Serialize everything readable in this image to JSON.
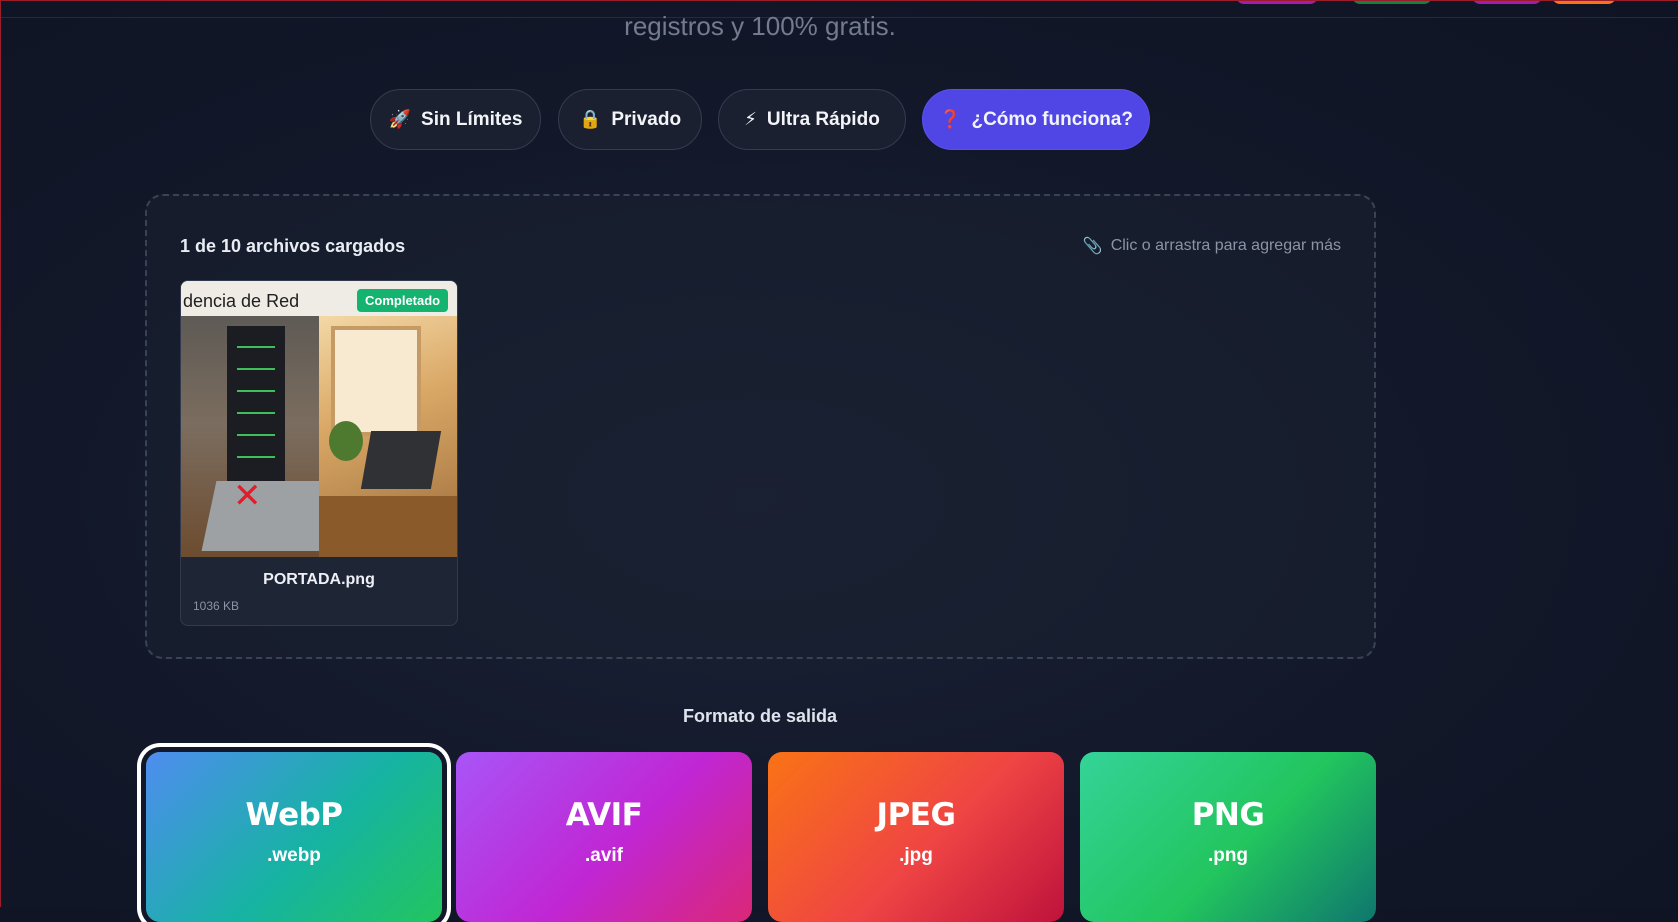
{
  "header": {
    "subtitle_fragment": "registros y 100% gratis."
  },
  "top_chip_colors": [
    "#a21caf",
    "#15803d",
    "#a21caf",
    "#f97316"
  ],
  "features": [
    {
      "label": "Sin Límites",
      "icon": "rocket-icon",
      "glyph": "🚀"
    },
    {
      "label": "Privado",
      "icon": "lock-icon",
      "glyph": "🔒"
    },
    {
      "label": "Ultra Rápido",
      "icon": "lightning-icon",
      "glyph": "⚡"
    },
    {
      "label": "¿Cómo funciona?",
      "icon": "question-icon",
      "glyph": "❓"
    }
  ],
  "upload": {
    "count_text": "1 de 10 archivos cargados",
    "hint_text": "Clic o arrastra para agregar más",
    "hint_icon": "paperclip-icon",
    "files": [
      {
        "name": "PORTADA.png",
        "size": "1036 KB",
        "status": "Completado",
        "thumb_text": "dencia de Red"
      }
    ]
  },
  "output": {
    "title": "Formato de salida",
    "selected": "WebP",
    "formats": [
      {
        "name": "WebP",
        "ext": ".webp",
        "gradient_from": "#4f8df0",
        "gradient_mid": "#16b3a3",
        "gradient_to": "#22c55e"
      },
      {
        "name": "AVIF",
        "ext": ".avif",
        "gradient_from": "#a855f7",
        "gradient_mid": "#c026d3",
        "gradient_to": "#db2777"
      },
      {
        "name": "JPEG",
        "ext": ".jpg",
        "gradient_from": "#f97316",
        "gradient_mid": "#ef4444",
        "gradient_to": "#be123c"
      },
      {
        "name": "PNG",
        "ext": ".png",
        "gradient_from": "#34d399",
        "gradient_mid": "#22c55e",
        "gradient_to": "#0f766e"
      }
    ]
  }
}
